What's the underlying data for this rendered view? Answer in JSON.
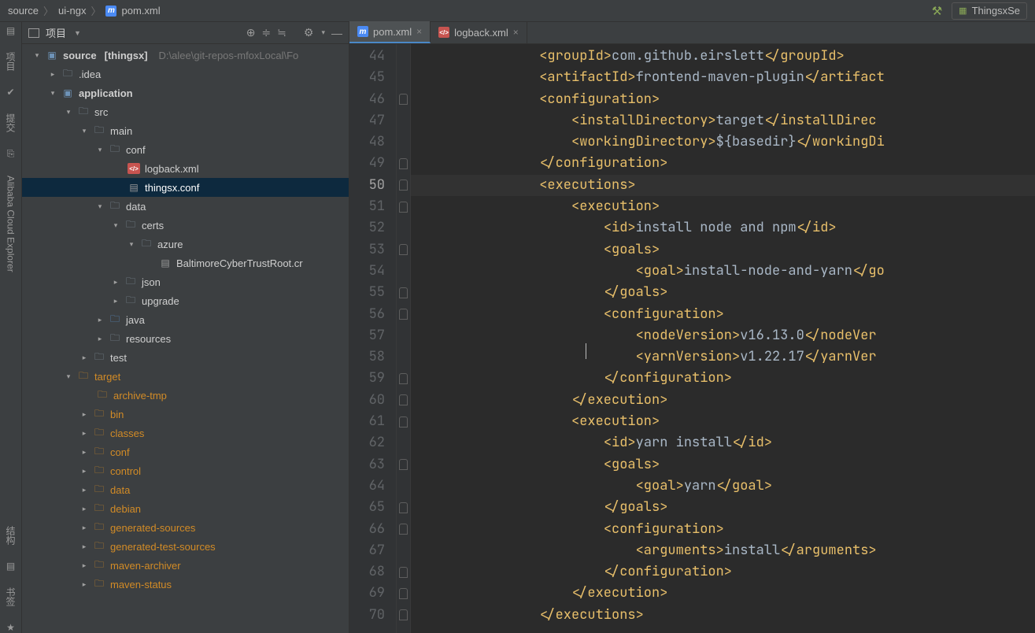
{
  "breadcrumb": {
    "a": "source",
    "b": "ui-ngx",
    "c": "pom.xml"
  },
  "runcfg": "ThingsxSe",
  "project": {
    "panel_title": "项目",
    "root_label": "source",
    "root_ctx": "[thingsx]",
    "root_path": "D:\\alee\\git-repos-mfoxLocal\\Fo",
    "tree": {
      "idea": ".idea",
      "application": "application",
      "src": "src",
      "main": "main",
      "conf": "conf",
      "logback": "logback.xml",
      "thingsx_conf": "thingsx.conf",
      "data": "data",
      "certs": "certs",
      "azure": "azure",
      "baltimore": "BaltimoreCyberTrustRoot.cr",
      "json": "json",
      "upgrade": "upgrade",
      "java": "java",
      "resources": "resources",
      "test": "test",
      "target": "target",
      "archive_tmp": "archive-tmp",
      "bin": "bin",
      "classes": "classes",
      "conf2": "conf",
      "control": "control",
      "data2": "data",
      "debian": "debian",
      "gen_src": "generated-sources",
      "gen_test": "generated-test-sources",
      "mvn_arch": "maven-archiver",
      "mvn_status": "maven-status"
    }
  },
  "leftstrip": {
    "project": "项目",
    "commit": "提交",
    "ali": "Alibaba Cloud Explorer",
    "struct": "结构",
    "bookmark": "书签"
  },
  "tabs": {
    "pom": "pom.xml",
    "logback": "logback.xml"
  },
  "editor": {
    "first_line": 44,
    "current_line": 50,
    "lines": [
      {
        "indent": 16,
        "seg": [
          {
            "c": "tag",
            "t": "<groupId>"
          },
          {
            "c": "text",
            "t": "com.github.eirslett"
          },
          {
            "c": "tag",
            "t": "</groupId>"
          }
        ]
      },
      {
        "indent": 16,
        "seg": [
          {
            "c": "tag",
            "t": "<artifactId>"
          },
          {
            "c": "text",
            "t": "frontend-maven-plugin"
          },
          {
            "c": "tag",
            "t": "</artifact"
          }
        ]
      },
      {
        "indent": 16,
        "seg": [
          {
            "c": "tag",
            "t": "<configuration>"
          }
        ]
      },
      {
        "indent": 20,
        "seg": [
          {
            "c": "tag",
            "t": "<installDirectory>"
          },
          {
            "c": "text",
            "t": "target"
          },
          {
            "c": "tag",
            "t": "</installDirec"
          }
        ]
      },
      {
        "indent": 20,
        "seg": [
          {
            "c": "tag",
            "t": "<workingDirectory>"
          },
          {
            "c": "text",
            "t": "${basedir}"
          },
          {
            "c": "tag",
            "t": "</workingDi"
          }
        ]
      },
      {
        "indent": 16,
        "seg": [
          {
            "c": "tag",
            "t": "</configuration>"
          }
        ]
      },
      {
        "indent": 16,
        "seg": [
          {
            "c": "tag",
            "t": "<executions>"
          }
        ]
      },
      {
        "indent": 20,
        "seg": [
          {
            "c": "tag",
            "t": "<execution>"
          }
        ]
      },
      {
        "indent": 24,
        "seg": [
          {
            "c": "tag",
            "t": "<id>"
          },
          {
            "c": "text",
            "t": "install node and npm"
          },
          {
            "c": "tag",
            "t": "</id>"
          }
        ]
      },
      {
        "indent": 24,
        "seg": [
          {
            "c": "tag",
            "t": "<goals>"
          }
        ]
      },
      {
        "indent": 28,
        "seg": [
          {
            "c": "tag",
            "t": "<goal>"
          },
          {
            "c": "text",
            "t": "install-node-and-yarn"
          },
          {
            "c": "tag",
            "t": "</go"
          }
        ]
      },
      {
        "indent": 24,
        "seg": [
          {
            "c": "tag",
            "t": "</goals>"
          }
        ]
      },
      {
        "indent": 24,
        "seg": [
          {
            "c": "tag",
            "t": "<configuration>"
          }
        ]
      },
      {
        "indent": 28,
        "seg": [
          {
            "c": "tag",
            "t": "<nodeVersion>"
          },
          {
            "c": "text",
            "t": "v16.13.0"
          },
          {
            "c": "tag",
            "t": "</nodeVer"
          }
        ]
      },
      {
        "indent": 28,
        "seg": [
          {
            "c": "tag",
            "t": "<yarnVersion>"
          },
          {
            "c": "text",
            "t": "v1.22.17"
          },
          {
            "c": "tag",
            "t": "</yarnVer"
          }
        ]
      },
      {
        "indent": 24,
        "seg": [
          {
            "c": "tag",
            "t": "</configuration>"
          }
        ]
      },
      {
        "indent": 20,
        "seg": [
          {
            "c": "tag",
            "t": "</execution>"
          }
        ]
      },
      {
        "indent": 20,
        "seg": [
          {
            "c": "tag",
            "t": "<execution>"
          }
        ]
      },
      {
        "indent": 24,
        "seg": [
          {
            "c": "tag",
            "t": "<id>"
          },
          {
            "c": "text",
            "t": "yarn install"
          },
          {
            "c": "tag",
            "t": "</id>"
          }
        ]
      },
      {
        "indent": 24,
        "seg": [
          {
            "c": "tag",
            "t": "<goals>"
          }
        ]
      },
      {
        "indent": 28,
        "seg": [
          {
            "c": "tag",
            "t": "<goal>"
          },
          {
            "c": "text",
            "t": "yarn"
          },
          {
            "c": "tag",
            "t": "</goal>"
          }
        ]
      },
      {
        "indent": 24,
        "seg": [
          {
            "c": "tag",
            "t": "</goals>"
          }
        ]
      },
      {
        "indent": 24,
        "seg": [
          {
            "c": "tag",
            "t": "<configuration>"
          }
        ]
      },
      {
        "indent": 28,
        "seg": [
          {
            "c": "tag",
            "t": "<arguments>"
          },
          {
            "c": "text",
            "t": "install"
          },
          {
            "c": "tag",
            "t": "</arguments>"
          }
        ]
      },
      {
        "indent": 24,
        "seg": [
          {
            "c": "tag",
            "t": "</configuration>"
          }
        ]
      },
      {
        "indent": 20,
        "seg": [
          {
            "c": "tag",
            "t": "</execution>"
          }
        ]
      },
      {
        "indent": 16,
        "seg": [
          {
            "c": "tag",
            "t": "</executions>"
          }
        ]
      }
    ],
    "fold_marks": [
      false,
      false,
      true,
      false,
      false,
      true,
      true,
      true,
      false,
      true,
      false,
      true,
      true,
      false,
      false,
      true,
      true,
      true,
      false,
      true,
      false,
      true,
      true,
      false,
      true,
      true,
      true
    ]
  }
}
